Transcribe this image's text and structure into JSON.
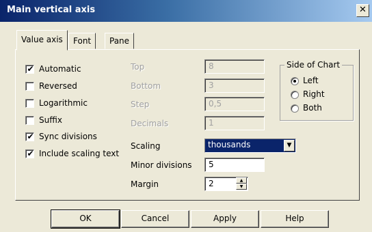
{
  "window": {
    "title": "Main vertical axis",
    "close_glyph": "✕"
  },
  "tabs": [
    {
      "label": "Value axis",
      "active": true
    },
    {
      "label": "Font",
      "active": false
    },
    {
      "label": "Pane",
      "active": false
    }
  ],
  "options": [
    {
      "label": "Automatic",
      "checked": true
    },
    {
      "label": "Reversed",
      "checked": false
    },
    {
      "label": "Logarithmic",
      "checked": false
    },
    {
      "label": "Suffix",
      "checked": false
    },
    {
      "label": "Sync divisions",
      "checked": true
    },
    {
      "label": "Include scaling text",
      "checked": true
    }
  ],
  "fields": {
    "top": {
      "label": "Top",
      "value": "8",
      "enabled": false
    },
    "bottom": {
      "label": "Bottom",
      "value": "3",
      "enabled": false
    },
    "step": {
      "label": "Step",
      "value": "0,5",
      "enabled": false
    },
    "decimals": {
      "label": "Decimals",
      "value": "1",
      "enabled": false
    },
    "scaling": {
      "label": "Scaling",
      "value": "thousands"
    },
    "minor_divisions": {
      "label": "Minor divisions",
      "value": "5"
    },
    "margin": {
      "label": "Margin",
      "value": "2"
    }
  },
  "side_of_chart": {
    "title": "Side of Chart",
    "options": [
      {
        "label": "Left",
        "selected": true
      },
      {
        "label": "Right",
        "selected": false
      },
      {
        "label": "Both",
        "selected": false
      }
    ]
  },
  "buttons": {
    "ok": "OK",
    "cancel": "Cancel",
    "apply": "Apply",
    "help": "Help"
  },
  "check_mark_glyph": "✔",
  "colors": {
    "title_bar": "#0A246A",
    "dialog_face": "#ECE9D8",
    "selection": "#0A246A"
  }
}
